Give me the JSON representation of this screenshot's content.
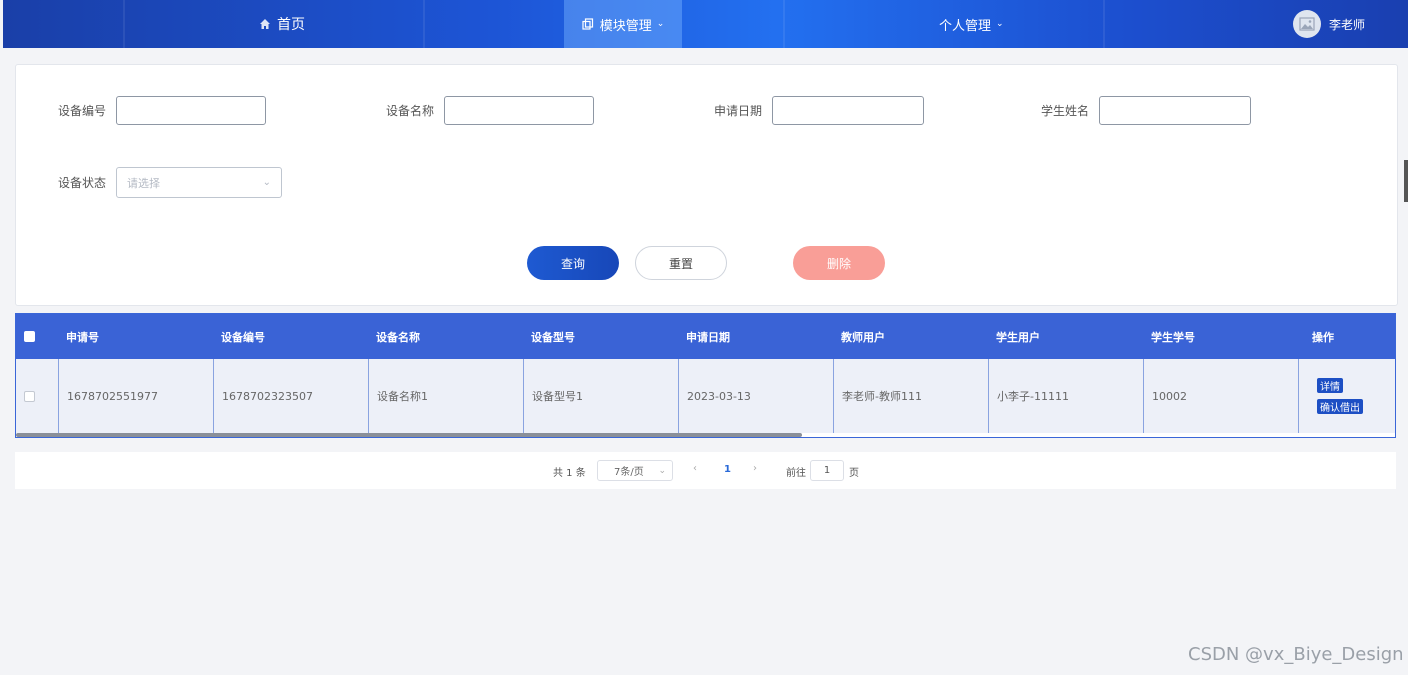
{
  "nav": {
    "home": "首页",
    "module": "模块管理",
    "personal": "个人管理",
    "user": "李老师"
  },
  "search": {
    "device_no_label": "设备编号",
    "device_name_label": "设备名称",
    "apply_date_label": "申请日期",
    "student_name_label": "学生姓名",
    "device_status_label": "设备状态",
    "device_status_placeholder": "请选择",
    "query_button": "查询",
    "reset_button": "重置",
    "delete_button": "删除"
  },
  "table": {
    "headers": [
      "申请号",
      "设备编号",
      "设备名称",
      "设备型号",
      "申请日期",
      "教师用户",
      "学生用户",
      "学生学号",
      "操作"
    ],
    "rows": [
      {
        "apply_no": "1678702551977",
        "device_no": "1678702323507",
        "device_name": "设备名称1",
        "device_model": "设备型号1",
        "apply_date": "2023-03-13",
        "teacher": "李老师-教师111",
        "student": "小李子-11111",
        "student_no": "10002",
        "detail_button": "详情",
        "confirm_button": "确认借出"
      }
    ]
  },
  "pagination": {
    "total": "共 1 条",
    "page_size": "7条/页",
    "current_page": "1",
    "goto_label": "前往",
    "goto_value": "1",
    "page_suffix": "页"
  },
  "watermark": "CSDN @vx_Biye_Design",
  "colors": {
    "nav_bg": "#1d55d6",
    "table_header": "#3a63d6",
    "query_button": "#1e5ad2",
    "delete_button": "#f99e97",
    "op_button": "#1d4fc4"
  }
}
